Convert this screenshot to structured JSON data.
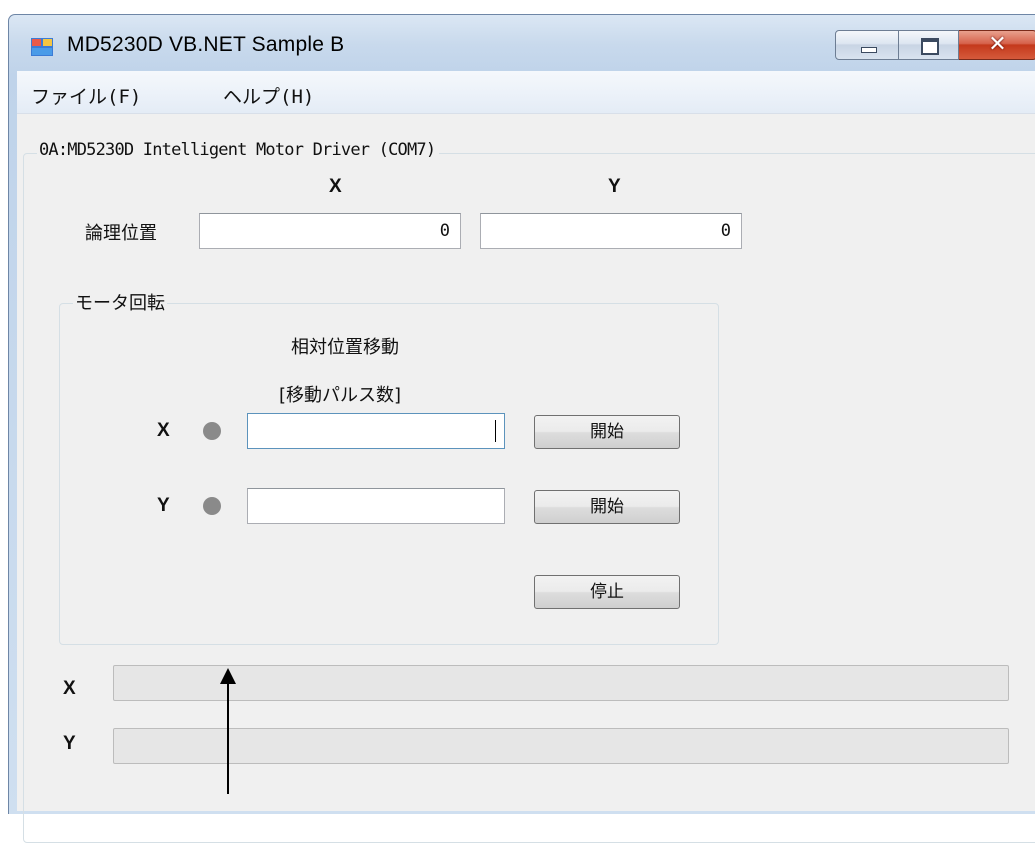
{
  "window": {
    "title": "MD5230D VB.NET Sample B"
  },
  "menu": [
    "ファイル(F)",
    "ヘルプ(H)"
  ],
  "device_group": {
    "label": "0A:MD5230D Intelligent Motor Driver (COM7)"
  },
  "position": {
    "label": "論理位置",
    "x_header": "X",
    "y_header": "Y",
    "x_value": "0",
    "y_value": "0"
  },
  "motor_group": {
    "label": "モータ回転",
    "mode_label": "相対位置移動",
    "pulse_label": "[移動パルス数]",
    "x_axis_label": "X",
    "y_axis_label": "Y",
    "x_input_value": "",
    "y_input_value": "",
    "start_x_label": "開始",
    "start_y_label": "開始",
    "stop_label": "停止"
  },
  "progress": {
    "x_label": "X",
    "y_label": "Y",
    "x_value": 0,
    "y_value": 0
  },
  "colors": {
    "led_off": "#8a8a8a",
    "progress_fill": "#06b025"
  }
}
